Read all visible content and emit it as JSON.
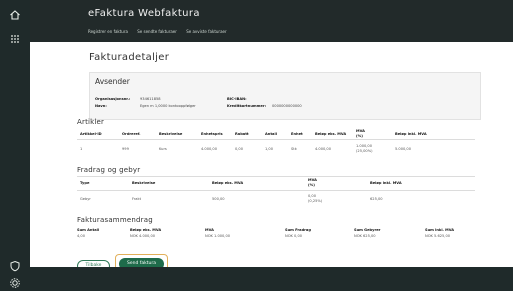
{
  "header": {
    "title": "eFaktura Webfaktura",
    "subnav": [
      "Registrer en faktura",
      "Se sendte fakturaer",
      "Se avviste fakturaer"
    ]
  },
  "page_title": "Fakturadetaljer",
  "avsender": {
    "title": "Avsender",
    "rows": [
      {
        "label": "Organisasjonsnr.:",
        "value": "934611858",
        "label2": "BIC-IBAN:",
        "value2": ""
      },
      {
        "label": "Navn:",
        "value": "Egen m 1,0000 kontooppfølger",
        "label2": "Kreditkortnummer:",
        "value2": "0000000000000"
      }
    ]
  },
  "artikler": {
    "title": "Artikler",
    "headers": [
      "Artikkel-ID",
      "Ordreref.",
      "Beskrivelse",
      "Enhetspris",
      "Rabatt",
      "Antall",
      "Enhet",
      "Beløp eks. MVA",
      "MVA\n(%)",
      "Beløp inkl. MVA"
    ],
    "row": [
      "1",
      "999",
      "Kurs",
      "4.000,00",
      "0,00",
      "1,00",
      "Stk",
      "4.000,00",
      "1.000,00\n(25,00%)",
      "5.000,00"
    ]
  },
  "fradrag": {
    "title": "Fradrag og gebyr",
    "headers": [
      "Type",
      "Beskrivelse",
      "Beløp eks. MVA",
      "MVA\n(%)",
      "Beløp inkl. MVA"
    ],
    "row": [
      "Gebyr",
      "Frakt",
      "500,00",
      "0,00\n(0,25%)",
      "625,00"
    ]
  },
  "sammendrag": {
    "title": "Fakturasammendrag",
    "items": [
      {
        "label": "Sum Antall",
        "value": "4,00"
      },
      {
        "label": "Beløp eks. MVA",
        "value": "NOK 4.000,00"
      },
      {
        "label": "MVA",
        "value": "NOK 1.000,00"
      },
      {
        "label": "Sum Fradrag",
        "value": "NOK 0,00"
      },
      {
        "label": "Sum Gebyrer",
        "value": "NOK 625,00"
      },
      {
        "label": "Sum inkl. MVA",
        "value": "NOK 5.625,00"
      }
    ]
  },
  "buttons": {
    "back": "Tilbake",
    "send": "Send faktura"
  },
  "icons": {
    "home": "home-icon",
    "grid": "grid-icon",
    "rail_bottom_1": "shield-icon",
    "rail_bottom_2": "settings-icon"
  },
  "colors": {
    "rail": "#1f2a2a",
    "header": "#222a2a",
    "primary": "#1e6b4a",
    "highlight": "#e2b05a"
  }
}
